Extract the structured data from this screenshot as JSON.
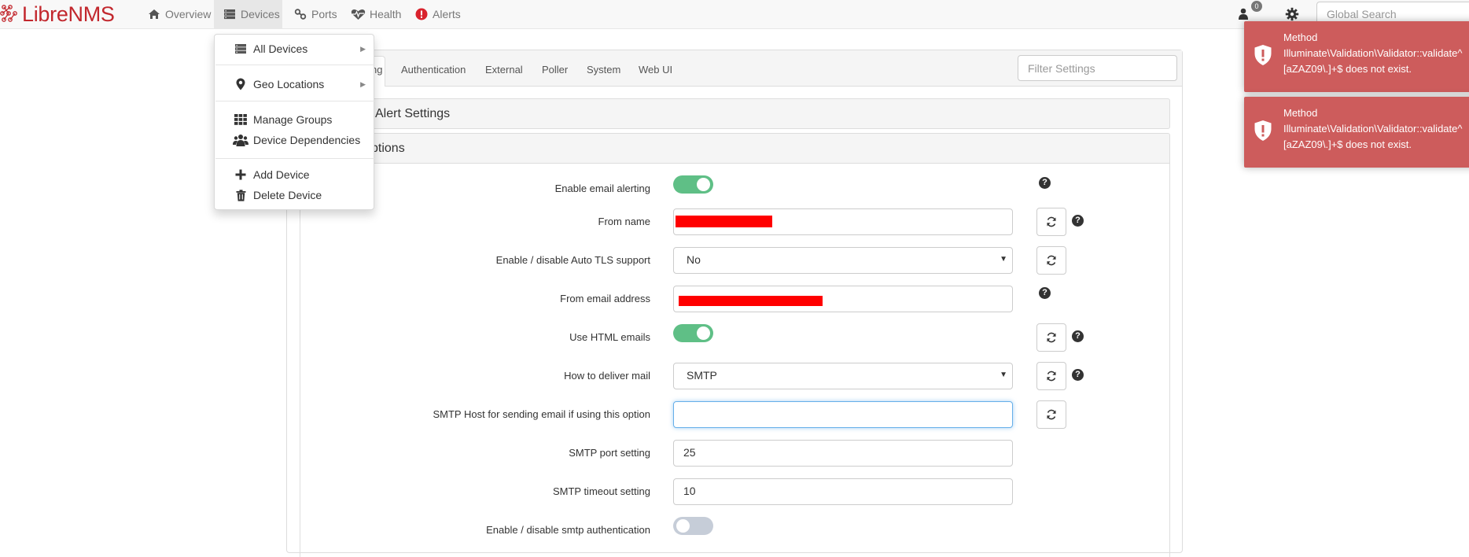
{
  "brand": {
    "libre": "Libre",
    "nms": "NMS"
  },
  "nav": {
    "overview": "Overview",
    "devices": "Devices",
    "ports": "Ports",
    "health": "Health",
    "alerts": "Alerts",
    "notification_count": "0",
    "search_placeholder": "Global Search"
  },
  "devices_menu": {
    "all_devices": "All Devices",
    "geo_locations": "Geo Locations",
    "manage_groups": "Manage Groups",
    "device_dependencies": "Device Dependencies",
    "add_device": "Add Device",
    "delete_device": "Delete Device"
  },
  "tabs": {
    "active_partial": "ng",
    "authentication": "Authentication",
    "external": "External",
    "poller": "Poller",
    "system": "System",
    "web_ui": "Web UI",
    "filter_placeholder": "Filter Settings"
  },
  "sections": {
    "alert_settings": "Alert Settings",
    "options_partial": "ptions"
  },
  "settings": {
    "enable_email_alerting": {
      "label": "Enable email alerting",
      "state": "on"
    },
    "from_name": {
      "label": "From name",
      "value": ""
    },
    "auto_tls": {
      "label": "Enable / disable Auto TLS support",
      "value": "No"
    },
    "from_email": {
      "label": "From email address",
      "value": ""
    },
    "use_html": {
      "label": "Use HTML emails",
      "state": "on"
    },
    "deliver_mail": {
      "label": "How to deliver mail",
      "value": "SMTP"
    },
    "smtp_host": {
      "label": "SMTP Host for sending email if using this option",
      "value": ""
    },
    "smtp_port": {
      "label": "SMTP port setting",
      "value": "25"
    },
    "smtp_timeout": {
      "label": "SMTP timeout setting",
      "value": "10"
    },
    "smtp_auth": {
      "label": "Enable / disable smtp authentication",
      "state": "off"
    }
  },
  "toasts": [
    {
      "message": "Method\nIlluminate\\Validation\\Validator::validate^\n[aZAZ09\\.]+$ does not exist."
    },
    {
      "message": "Method\nIlluminate\\Validation\\Validator::validate^\n[aZAZ09\\.]+$ does not exist."
    }
  ],
  "colors": {
    "brand_red": "#c2272d",
    "toggle_on": "#5fbf86",
    "toast_bg": "#cd5c5c",
    "redaction": "#ff0000"
  }
}
